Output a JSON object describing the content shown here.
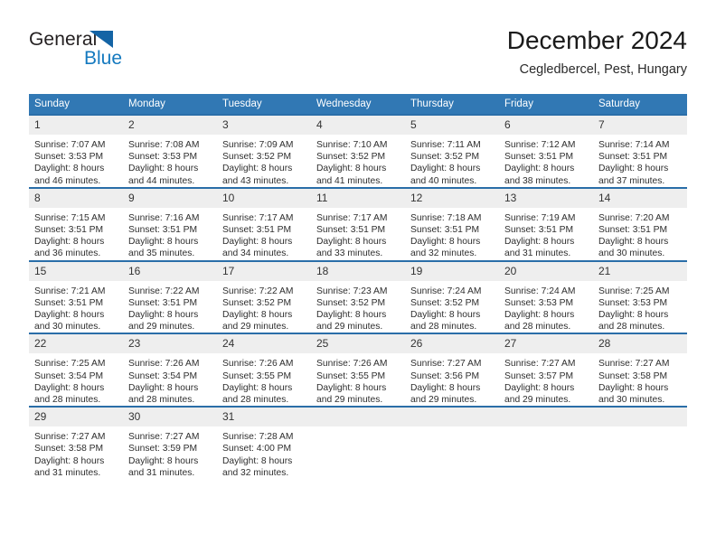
{
  "brand": {
    "name_part1": "General",
    "name_part2": "Blue",
    "triangle_icon": "triangle-icon",
    "color_dark": "#231f20",
    "color_blue": "#1479bf"
  },
  "header": {
    "title": "December 2024",
    "location": "Cegledbercel, Pest, Hungary"
  },
  "colors": {
    "header_row_bg": "#3178b4",
    "row_top_border": "#2a6ea8",
    "daynum_bg": "#eeeeee",
    "text": "#2e2e2e"
  },
  "weekday_headers": [
    "Sunday",
    "Monday",
    "Tuesday",
    "Wednesday",
    "Thursday",
    "Friday",
    "Saturday"
  ],
  "weeks": [
    [
      {
        "day": "1",
        "sunrise": "Sunrise: 7:07 AM",
        "sunset": "Sunset: 3:53 PM",
        "daylight1": "Daylight: 8 hours",
        "daylight2": "and 46 minutes."
      },
      {
        "day": "2",
        "sunrise": "Sunrise: 7:08 AM",
        "sunset": "Sunset: 3:53 PM",
        "daylight1": "Daylight: 8 hours",
        "daylight2": "and 44 minutes."
      },
      {
        "day": "3",
        "sunrise": "Sunrise: 7:09 AM",
        "sunset": "Sunset: 3:52 PM",
        "daylight1": "Daylight: 8 hours",
        "daylight2": "and 43 minutes."
      },
      {
        "day": "4",
        "sunrise": "Sunrise: 7:10 AM",
        "sunset": "Sunset: 3:52 PM",
        "daylight1": "Daylight: 8 hours",
        "daylight2": "and 41 minutes."
      },
      {
        "day": "5",
        "sunrise": "Sunrise: 7:11 AM",
        "sunset": "Sunset: 3:52 PM",
        "daylight1": "Daylight: 8 hours",
        "daylight2": "and 40 minutes."
      },
      {
        "day": "6",
        "sunrise": "Sunrise: 7:12 AM",
        "sunset": "Sunset: 3:51 PM",
        "daylight1": "Daylight: 8 hours",
        "daylight2": "and 38 minutes."
      },
      {
        "day": "7",
        "sunrise": "Sunrise: 7:14 AM",
        "sunset": "Sunset: 3:51 PM",
        "daylight1": "Daylight: 8 hours",
        "daylight2": "and 37 minutes."
      }
    ],
    [
      {
        "day": "8",
        "sunrise": "Sunrise: 7:15 AM",
        "sunset": "Sunset: 3:51 PM",
        "daylight1": "Daylight: 8 hours",
        "daylight2": "and 36 minutes."
      },
      {
        "day": "9",
        "sunrise": "Sunrise: 7:16 AM",
        "sunset": "Sunset: 3:51 PM",
        "daylight1": "Daylight: 8 hours",
        "daylight2": "and 35 minutes."
      },
      {
        "day": "10",
        "sunrise": "Sunrise: 7:17 AM",
        "sunset": "Sunset: 3:51 PM",
        "daylight1": "Daylight: 8 hours",
        "daylight2": "and 34 minutes."
      },
      {
        "day": "11",
        "sunrise": "Sunrise: 7:17 AM",
        "sunset": "Sunset: 3:51 PM",
        "daylight1": "Daylight: 8 hours",
        "daylight2": "and 33 minutes."
      },
      {
        "day": "12",
        "sunrise": "Sunrise: 7:18 AM",
        "sunset": "Sunset: 3:51 PM",
        "daylight1": "Daylight: 8 hours",
        "daylight2": "and 32 minutes."
      },
      {
        "day": "13",
        "sunrise": "Sunrise: 7:19 AM",
        "sunset": "Sunset: 3:51 PM",
        "daylight1": "Daylight: 8 hours",
        "daylight2": "and 31 minutes."
      },
      {
        "day": "14",
        "sunrise": "Sunrise: 7:20 AM",
        "sunset": "Sunset: 3:51 PM",
        "daylight1": "Daylight: 8 hours",
        "daylight2": "and 30 minutes."
      }
    ],
    [
      {
        "day": "15",
        "sunrise": "Sunrise: 7:21 AM",
        "sunset": "Sunset: 3:51 PM",
        "daylight1": "Daylight: 8 hours",
        "daylight2": "and 30 minutes."
      },
      {
        "day": "16",
        "sunrise": "Sunrise: 7:22 AM",
        "sunset": "Sunset: 3:51 PM",
        "daylight1": "Daylight: 8 hours",
        "daylight2": "and 29 minutes."
      },
      {
        "day": "17",
        "sunrise": "Sunrise: 7:22 AM",
        "sunset": "Sunset: 3:52 PM",
        "daylight1": "Daylight: 8 hours",
        "daylight2": "and 29 minutes."
      },
      {
        "day": "18",
        "sunrise": "Sunrise: 7:23 AM",
        "sunset": "Sunset: 3:52 PM",
        "daylight1": "Daylight: 8 hours",
        "daylight2": "and 29 minutes."
      },
      {
        "day": "19",
        "sunrise": "Sunrise: 7:24 AM",
        "sunset": "Sunset: 3:52 PM",
        "daylight1": "Daylight: 8 hours",
        "daylight2": "and 28 minutes."
      },
      {
        "day": "20",
        "sunrise": "Sunrise: 7:24 AM",
        "sunset": "Sunset: 3:53 PM",
        "daylight1": "Daylight: 8 hours",
        "daylight2": "and 28 minutes."
      },
      {
        "day": "21",
        "sunrise": "Sunrise: 7:25 AM",
        "sunset": "Sunset: 3:53 PM",
        "daylight1": "Daylight: 8 hours",
        "daylight2": "and 28 minutes."
      }
    ],
    [
      {
        "day": "22",
        "sunrise": "Sunrise: 7:25 AM",
        "sunset": "Sunset: 3:54 PM",
        "daylight1": "Daylight: 8 hours",
        "daylight2": "and 28 minutes."
      },
      {
        "day": "23",
        "sunrise": "Sunrise: 7:26 AM",
        "sunset": "Sunset: 3:54 PM",
        "daylight1": "Daylight: 8 hours",
        "daylight2": "and 28 minutes."
      },
      {
        "day": "24",
        "sunrise": "Sunrise: 7:26 AM",
        "sunset": "Sunset: 3:55 PM",
        "daylight1": "Daylight: 8 hours",
        "daylight2": "and 28 minutes."
      },
      {
        "day": "25",
        "sunrise": "Sunrise: 7:26 AM",
        "sunset": "Sunset: 3:55 PM",
        "daylight1": "Daylight: 8 hours",
        "daylight2": "and 29 minutes."
      },
      {
        "day": "26",
        "sunrise": "Sunrise: 7:27 AM",
        "sunset": "Sunset: 3:56 PM",
        "daylight1": "Daylight: 8 hours",
        "daylight2": "and 29 minutes."
      },
      {
        "day": "27",
        "sunrise": "Sunrise: 7:27 AM",
        "sunset": "Sunset: 3:57 PM",
        "daylight1": "Daylight: 8 hours",
        "daylight2": "and 29 minutes."
      },
      {
        "day": "28",
        "sunrise": "Sunrise: 7:27 AM",
        "sunset": "Sunset: 3:58 PM",
        "daylight1": "Daylight: 8 hours",
        "daylight2": "and 30 minutes."
      }
    ],
    [
      {
        "day": "29",
        "sunrise": "Sunrise: 7:27 AM",
        "sunset": "Sunset: 3:58 PM",
        "daylight1": "Daylight: 8 hours",
        "daylight2": "and 31 minutes."
      },
      {
        "day": "30",
        "sunrise": "Sunrise: 7:27 AM",
        "sunset": "Sunset: 3:59 PM",
        "daylight1": "Daylight: 8 hours",
        "daylight2": "and 31 minutes."
      },
      {
        "day": "31",
        "sunrise": "Sunrise: 7:28 AM",
        "sunset": "Sunset: 4:00 PM",
        "daylight1": "Daylight: 8 hours",
        "daylight2": "and 32 minutes."
      },
      {
        "day": "",
        "sunrise": "",
        "sunset": "",
        "daylight1": "",
        "daylight2": ""
      },
      {
        "day": "",
        "sunrise": "",
        "sunset": "",
        "daylight1": "",
        "daylight2": ""
      },
      {
        "day": "",
        "sunrise": "",
        "sunset": "",
        "daylight1": "",
        "daylight2": ""
      },
      {
        "day": "",
        "sunrise": "",
        "sunset": "",
        "daylight1": "",
        "daylight2": ""
      }
    ]
  ]
}
